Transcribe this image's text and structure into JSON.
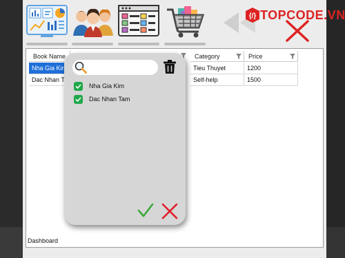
{
  "toolbar": {
    "buttons": [
      {
        "name": "dashboard",
        "icon": "dashboard-chart-icon"
      },
      {
        "name": "customers",
        "icon": "people-group-icon"
      },
      {
        "name": "categories",
        "icon": "browser-list-icon"
      },
      {
        "name": "orders",
        "icon": "shopping-cart-icon"
      }
    ]
  },
  "brand": {
    "text": "TOPCODE.VN",
    "color": "#dd2222"
  },
  "table": {
    "columns": [
      "Book Name",
      "Category",
      "Price"
    ],
    "rows": [
      {
        "book": "Nha Gia Kim",
        "category": "Tieu Thuyet",
        "price": "1200"
      },
      {
        "book": "Dac Nhan Tam",
        "category": "Self-help",
        "price": "1500"
      }
    ]
  },
  "filter_popup": {
    "search_placeholder": "",
    "options": [
      {
        "label": "Nha Gia Kim",
        "checked": true
      },
      {
        "label": "Dac Nhan Tam",
        "checked": true
      }
    ],
    "apply_icon": "check-icon",
    "cancel_icon": "close-x-icon"
  },
  "status_bar": {
    "label": "Dashboard"
  },
  "colors": {
    "selection": "#1e6fd9",
    "check": "#20a84a",
    "accent_red": "#dd2222"
  }
}
